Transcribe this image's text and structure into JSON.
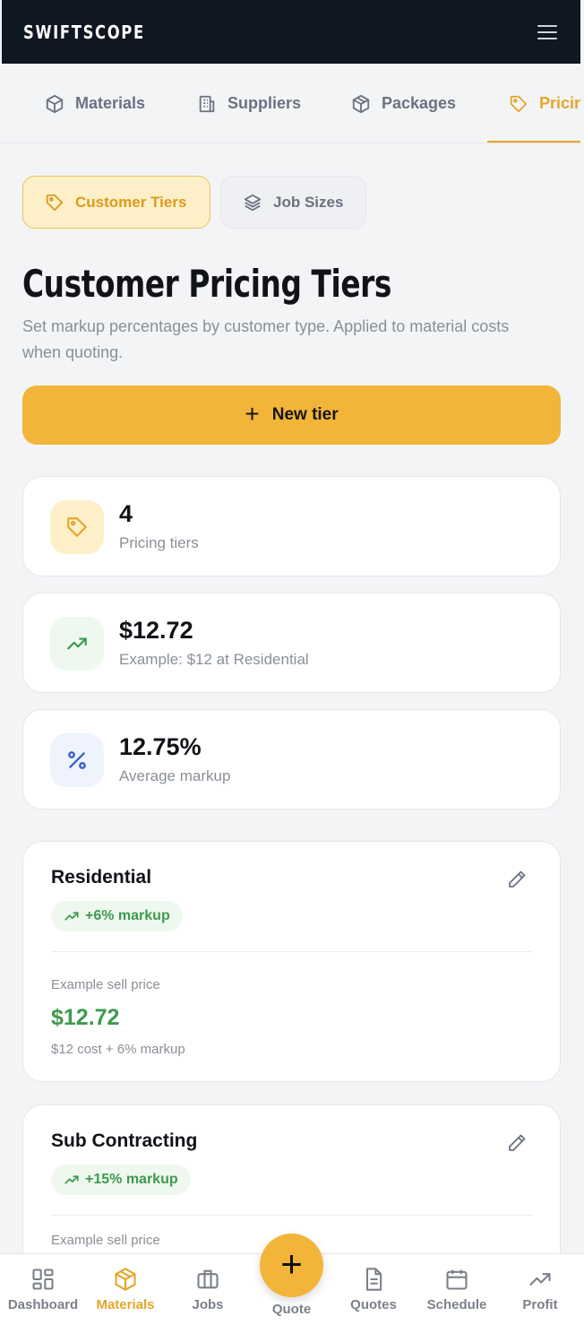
{
  "app": {
    "brand": "SWIFTSCOPE"
  },
  "top_tabs": [
    {
      "label": "Materials",
      "icon": "box-icon"
    },
    {
      "label": "Suppliers",
      "icon": "building-icon"
    },
    {
      "label": "Packages",
      "icon": "package-icon"
    },
    {
      "label": "Pricing",
      "icon": "tag-icon",
      "active": true
    }
  ],
  "sub_tabs": [
    {
      "label": "Customer Tiers",
      "active": true
    },
    {
      "label": "Job Sizes",
      "active": false
    }
  ],
  "page": {
    "title": "Customer Pricing Tiers",
    "description": "Set markup percentages by customer type. Applied to material costs when quoting.",
    "new_button": "New tier"
  },
  "stats": [
    {
      "value": "4",
      "label": "Pricing tiers",
      "icon": "tag-icon",
      "color": "#fdf0c8"
    },
    {
      "value": "$12.72",
      "label": "Example: $12 at Residential",
      "icon": "trend-up-icon",
      "color": "#eef8ef"
    },
    {
      "value": "12.75%",
      "label": "Average markup",
      "icon": "percent-icon",
      "color": "#eef3fd"
    }
  ],
  "tiers": [
    {
      "name": "Residential",
      "markup": "+6% markup",
      "example_label": "Example sell price",
      "example_price": "$12.72",
      "example_formula": "$12 cost + 6% markup"
    },
    {
      "name": "Sub Contracting",
      "markup": "+15% markup",
      "example_label": "Example sell price",
      "example_price": "",
      "example_formula": ""
    }
  ],
  "bottom_nav": [
    {
      "label": "Dashboard",
      "icon": "grid-icon"
    },
    {
      "label": "Materials",
      "icon": "box-icon",
      "active": true
    },
    {
      "label": "Jobs",
      "icon": "briefcase-icon"
    },
    {
      "label": "Quote",
      "icon": "plus-icon"
    },
    {
      "label": "Quotes",
      "icon": "document-icon"
    },
    {
      "label": "Schedule",
      "icon": "calendar-icon"
    },
    {
      "label": "Profit",
      "icon": "trend-up-icon"
    }
  ],
  "colors": {
    "accent": "#f2b53a",
    "accent_text": "#e6a52a",
    "success": "#3e9a4f",
    "header_bg": "#0f1722"
  }
}
